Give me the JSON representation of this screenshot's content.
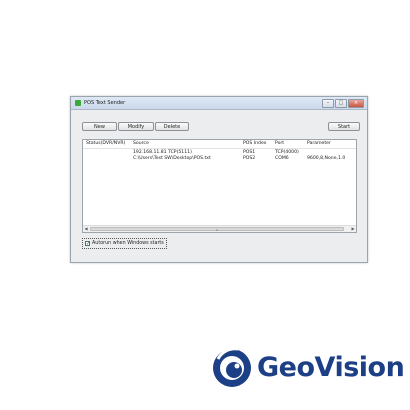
{
  "window": {
    "title": "POS Text Sender",
    "controls": {
      "minimize": "–",
      "maximize": "□",
      "close": "×"
    }
  },
  "toolbar": {
    "new_label": "New",
    "modify_label": "Modify",
    "delete_label": "Delete",
    "start_label": "Start"
  },
  "list": {
    "columns": [
      "Status(DVR/NVR)",
      "Source",
      "POS Index",
      "Port",
      "Parameter"
    ],
    "rows": [
      [
        "",
        "192.168.11.81 TCP(5111)",
        "POS1",
        "TCP(4000)",
        ""
      ],
      [
        "",
        "C:\\Users\\Test SW\\Desktop\\POS.txt",
        "POS2",
        "COM6",
        "9600,8,None,1.0"
      ]
    ],
    "scroll_left": "◀",
    "scroll_right": "▶",
    "scroll_grip": "≡"
  },
  "autorun": {
    "label": "Autorun when Windows starts",
    "checked": true,
    "check_glyph": "✓"
  },
  "brand": {
    "name": "GeoVision",
    "color": "#1d3f86"
  }
}
